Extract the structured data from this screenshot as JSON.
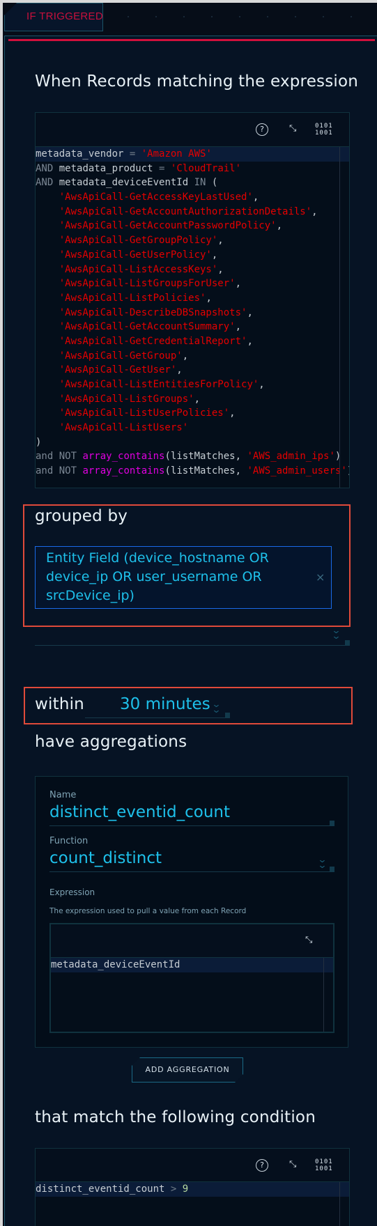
{
  "tab": {
    "label": "IF TRIGGERED"
  },
  "colors": {
    "accent_red": "#d0103c",
    "cyan": "#1ec0ea",
    "string": "#e60000",
    "function": "#e000e0",
    "highlight_box": "#e04a3a"
  },
  "expression_section": {
    "title": "When Records matching the expression",
    "toolbar_icons": [
      "help-icon",
      "expand-icon",
      "binary-icon"
    ],
    "help_glyph": "?",
    "binary_glyph": [
      "0101",
      "1001"
    ],
    "lines": [
      [
        {
          "t": "metadata_vendor ",
          "c": "id"
        },
        {
          "t": "=",
          "c": "op"
        },
        {
          "t": " ",
          "c": "id"
        },
        {
          "t": "'Amazon AWS'",
          "c": "str"
        }
      ],
      [
        {
          "t": "AND",
          "c": "kw"
        },
        {
          "t": " metadata_product ",
          "c": "id"
        },
        {
          "t": "=",
          "c": "op"
        },
        {
          "t": " ",
          "c": "id"
        },
        {
          "t": "'CloudTrail'",
          "c": "str"
        }
      ],
      [
        {
          "t": "AND",
          "c": "kw"
        },
        {
          "t": " metadata_deviceEventId ",
          "c": "id"
        },
        {
          "t": "IN",
          "c": "kw"
        },
        {
          "t": " (",
          "c": "id"
        }
      ],
      [
        {
          "t": "    ",
          "c": "id"
        },
        {
          "t": "'AwsApiCall-GetAccessKeyLastUsed'",
          "c": "str"
        },
        {
          "t": ",",
          "c": "id"
        }
      ],
      [
        {
          "t": "    ",
          "c": "id"
        },
        {
          "t": "'AwsApiCall-GetAccountAuthorizationDetails'",
          "c": "str"
        },
        {
          "t": ",",
          "c": "id"
        }
      ],
      [
        {
          "t": "    ",
          "c": "id"
        },
        {
          "t": "'AwsApiCall-GetAccountPasswordPolicy'",
          "c": "str"
        },
        {
          "t": ",",
          "c": "id"
        }
      ],
      [
        {
          "t": "    ",
          "c": "id"
        },
        {
          "t": "'AwsApiCall-GetGroupPolicy'",
          "c": "str"
        },
        {
          "t": ",",
          "c": "id"
        }
      ],
      [
        {
          "t": "    ",
          "c": "id"
        },
        {
          "t": "'AwsApiCall-GetUserPolicy'",
          "c": "str"
        },
        {
          "t": ",",
          "c": "id"
        }
      ],
      [
        {
          "t": "    ",
          "c": "id"
        },
        {
          "t": "'AwsApiCall-ListAccessKeys'",
          "c": "str"
        },
        {
          "t": ",",
          "c": "id"
        }
      ],
      [
        {
          "t": "    ",
          "c": "id"
        },
        {
          "t": "'AwsApiCall-ListGroupsForUser'",
          "c": "str"
        },
        {
          "t": ",",
          "c": "id"
        }
      ],
      [
        {
          "t": "    ",
          "c": "id"
        },
        {
          "t": "'AwsApiCall-ListPolicies'",
          "c": "str"
        },
        {
          "t": ",",
          "c": "id"
        }
      ],
      [
        {
          "t": "    ",
          "c": "id"
        },
        {
          "t": "'AwsApiCall-DescribeDBSnapshots'",
          "c": "str"
        },
        {
          "t": ",",
          "c": "id"
        }
      ],
      [
        {
          "t": "    ",
          "c": "id"
        },
        {
          "t": "'AwsApiCall-GetAccountSummary'",
          "c": "str"
        },
        {
          "t": ",",
          "c": "id"
        }
      ],
      [
        {
          "t": "    ",
          "c": "id"
        },
        {
          "t": "'AwsApiCall-GetCredentialReport'",
          "c": "str"
        },
        {
          "t": ",",
          "c": "id"
        }
      ],
      [
        {
          "t": "    ",
          "c": "id"
        },
        {
          "t": "'AwsApiCall-GetGroup'",
          "c": "str"
        },
        {
          "t": ",",
          "c": "id"
        }
      ],
      [
        {
          "t": "    ",
          "c": "id"
        },
        {
          "t": "'AwsApiCall-GetUser'",
          "c": "str"
        },
        {
          "t": ",",
          "c": "id"
        }
      ],
      [
        {
          "t": "    ",
          "c": "id"
        },
        {
          "t": "'AwsApiCall-ListEntitiesForPolicy'",
          "c": "str"
        },
        {
          "t": ",",
          "c": "id"
        }
      ],
      [
        {
          "t": "    ",
          "c": "id"
        },
        {
          "t": "'AwsApiCall-ListGroups'",
          "c": "str"
        },
        {
          "t": ",",
          "c": "id"
        }
      ],
      [
        {
          "t": "    ",
          "c": "id"
        },
        {
          "t": "'AwsApiCall-ListUserPolicies'",
          "c": "str"
        },
        {
          "t": ",",
          "c": "id"
        }
      ],
      [
        {
          "t": "    ",
          "c": "id"
        },
        {
          "t": "'AwsApiCall-ListUsers'",
          "c": "str"
        }
      ],
      [
        {
          "t": ")",
          "c": "id"
        }
      ],
      [
        {
          "t": "and NOT",
          "c": "kw"
        },
        {
          "t": " ",
          "c": "id"
        },
        {
          "t": "array_contains",
          "c": "fn"
        },
        {
          "t": "(listMatches, ",
          "c": "id"
        },
        {
          "t": "'AWS_admin_ips'",
          "c": "str"
        },
        {
          "t": ")",
          "c": "id"
        }
      ],
      [
        {
          "t": "and NOT",
          "c": "kw"
        },
        {
          "t": " ",
          "c": "id"
        },
        {
          "t": "array_contains",
          "c": "fn"
        },
        {
          "t": "(listMatches, ",
          "c": "id"
        },
        {
          "t": "'AWS_admin_users'",
          "c": "str"
        },
        {
          "t": ")",
          "c": "id"
        }
      ]
    ]
  },
  "grouped_by": {
    "title": "grouped by",
    "chip": "Entity Field (device_hostname OR device_ip OR user_username OR srcDevice_ip)",
    "remove_glyph": "×"
  },
  "within": {
    "label": "within",
    "value": "30 minutes"
  },
  "aggregations": {
    "title": "have aggregations",
    "name_label": "Name",
    "name_value": "distinct_eventid_count",
    "function_label": "Function",
    "function_value": "count_distinct",
    "expression_label": "Expression",
    "expression_help": "The expression used to pull a value from each Record",
    "expression_code": "metadata_deviceEventId",
    "add_button": "ADD AGGREGATION"
  },
  "condition": {
    "title": "that match the following condition",
    "lines": [
      [
        {
          "t": "distinct_eventid_count ",
          "c": "id"
        },
        {
          "t": ">",
          "c": "op"
        },
        {
          "t": " ",
          "c": "id"
        },
        {
          "t": "9",
          "c": "num"
        }
      ]
    ]
  }
}
